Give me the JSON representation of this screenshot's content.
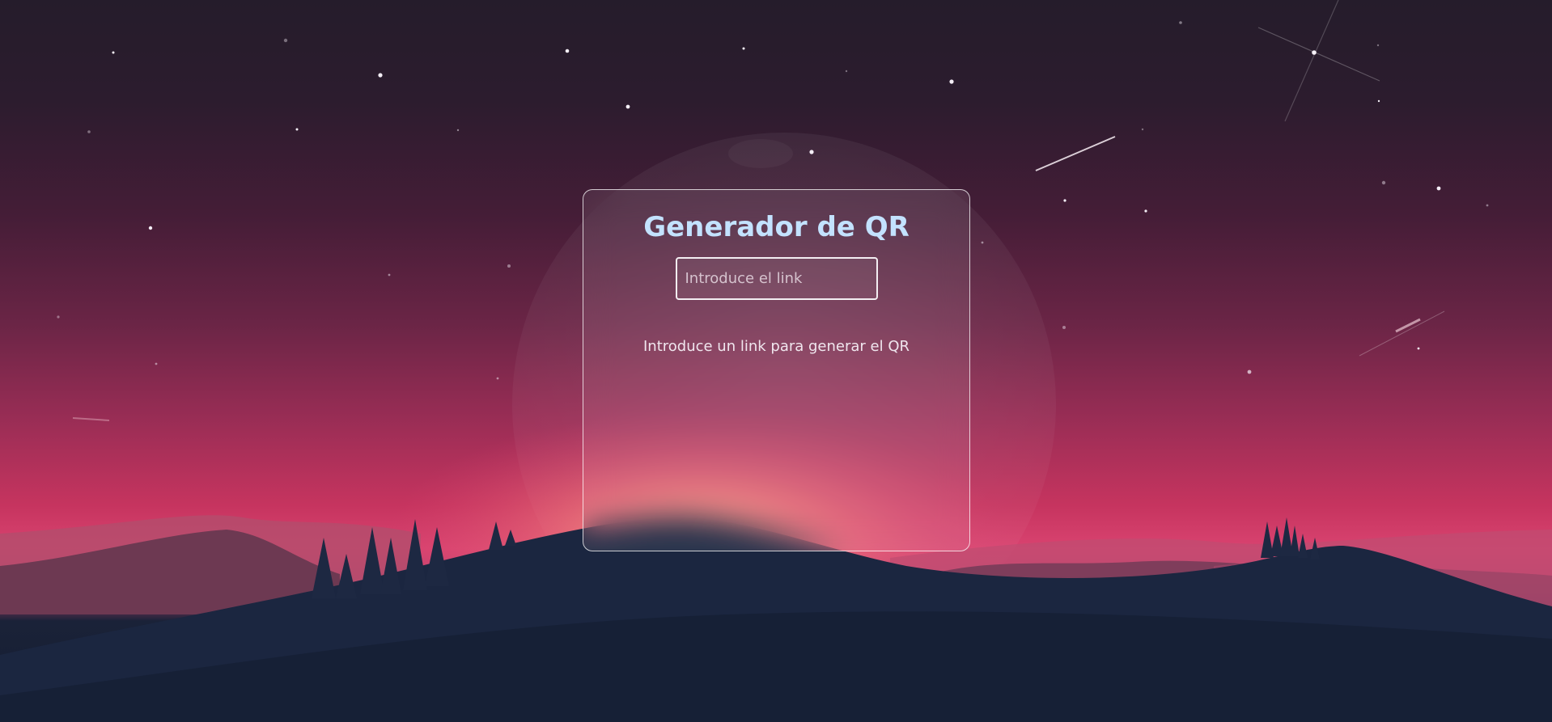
{
  "app": {
    "title": "Generador de QR"
  },
  "form": {
    "link_placeholder": "Introduce el link",
    "link_value": ""
  },
  "status": {
    "hint": "Introduce un link para generar el QR"
  },
  "colors": {
    "title": "#c3e2ff",
    "sky_top": "#251c2b",
    "sky_horizon": "#d94370",
    "ground": "#151d30"
  }
}
